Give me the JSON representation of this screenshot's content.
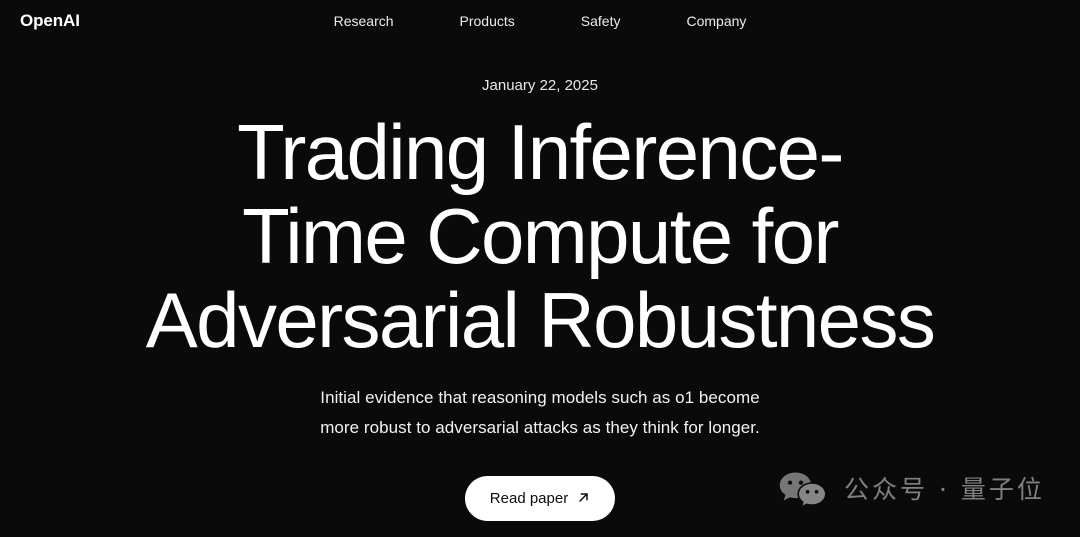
{
  "theme": {
    "background": "#0a0a0a",
    "text_primary": "#ffffff",
    "text_secondary": "#ececec",
    "button_bg": "#ffffff",
    "button_text": "#0d0d0d",
    "watermark_text": "#c9c9c9"
  },
  "header": {
    "brand": "OpenAI",
    "nav": [
      {
        "label": "Research"
      },
      {
        "label": "Products"
      },
      {
        "label": "Safety"
      },
      {
        "label": "Company"
      }
    ]
  },
  "hero": {
    "date": "January 22, 2025",
    "headline_lines": [
      "Trading Inference-",
      "Time Compute for",
      "Adversarial Robustness"
    ],
    "headline_full": "Trading Inference-Time Compute for Adversarial Robustness",
    "subtitle_lines": [
      "Initial evidence that reasoning models such as o1 become",
      "more robust to adversarial attacks as they think for longer."
    ],
    "subtitle_full": "Initial evidence that reasoning models such as o1 become more robust to adversarial attacks as they think for longer.",
    "cta": {
      "label": "Read paper",
      "icon": "arrow-up-right-icon",
      "icon_glyph": "↗"
    }
  },
  "watermark": {
    "icon": "wechat-icon",
    "text": "公众号 · 量子位"
  }
}
